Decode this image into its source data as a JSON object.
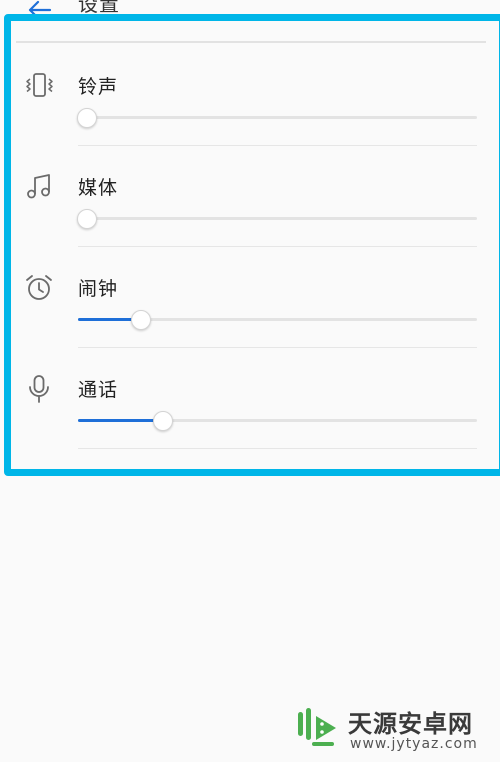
{
  "header": {
    "title": "设置"
  },
  "volume_items": [
    {
      "label": "铃声",
      "icon": "vibrate-ring-icon",
      "level": 0.02
    },
    {
      "label": "媒体",
      "icon": "music-note-icon",
      "level": 0.02
    },
    {
      "label": "闹钟",
      "icon": "alarm-clock-icon",
      "level": 0.155
    },
    {
      "label": "通话",
      "icon": "microphone-icon",
      "level": 0.21
    }
  ],
  "colors": {
    "accent": "#1e6fd8",
    "highlight_frame": "#00b6e8",
    "icon": "#6b6b6b",
    "track": "#e3e3e3",
    "background": "#fafafa",
    "watermark_green": "#4caf50"
  },
  "watermark": {
    "title": "天源安卓网",
    "url": "www.jytyaz.com"
  }
}
